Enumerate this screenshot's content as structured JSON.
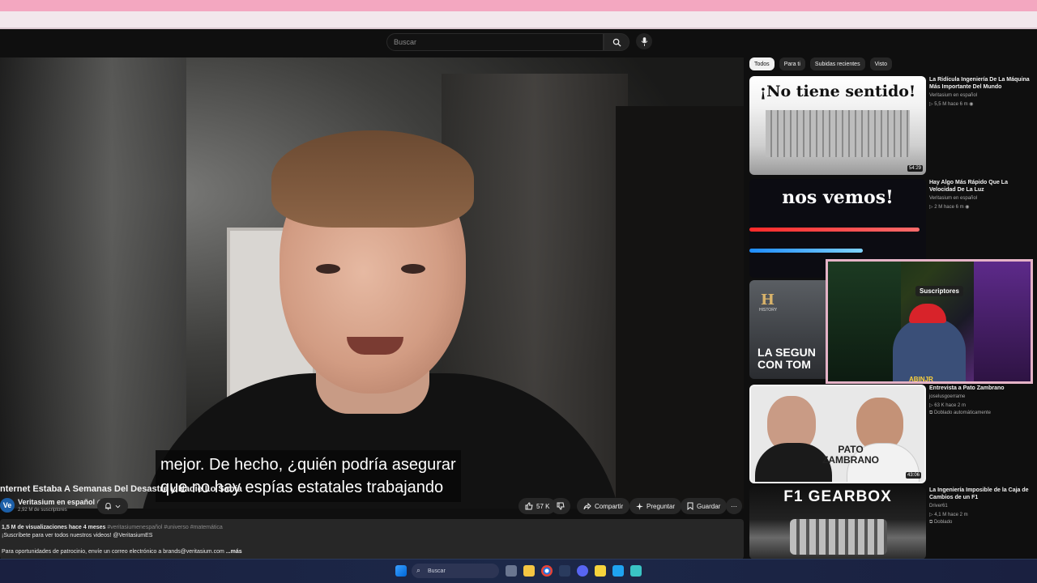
{
  "search": {
    "placeholder": "Buscar"
  },
  "video": {
    "subtitles": [
      "mejor. De hecho, ¿quién podría asegurar",
      "que no hay espías estatales trabajando"
    ],
    "title": "nternet Estaba A Semanas Del Desastre y Nadie Lo Sabía"
  },
  "channel": {
    "name": "Veritasium en español",
    "avatar_text": "Ve",
    "subscribers": "2,92 M de suscriptores"
  },
  "actions": {
    "likes": "57 K",
    "share": "Compartir",
    "ask": "Preguntar",
    "save": "Guardar"
  },
  "description": {
    "views_line": "1,5 M de visualizaciones  hace 4 meses",
    "hashtags": "#veritasiumenespañol #universo #matemática",
    "line2": "¡Suscríbete para ver todos nuestros videos! @VeritasiumES",
    "line3": "Para oportunidades de patrocinio, envíe un correo electrónico a brands@veritasium.com",
    "more": "...más"
  },
  "chips": [
    "Todos",
    "Para ti",
    "Subidas recientes",
    "Visto"
  ],
  "recommendations": [
    {
      "title": "La Ridícula Ingeniería De La Máquina Más Importante Del Mundo",
      "channel": "Veritasium en español",
      "meta": "5,5 M   hace 6 m",
      "thumb_text": "¡No tiene sentido!",
      "duration": "54:29"
    },
    {
      "title": "Hay Algo Más Rápido Que La Velocidad De La Luz",
      "channel": "Veritasium en español",
      "meta": "2 M   hace 6 m",
      "thumb_text": "nos vemos!"
    },
    {
      "thumb_text": "LA SEGUN CON TOM",
      "thumb_logo": "H",
      "thumb_logo_sub": "HISTORY"
    },
    {
      "title": "Entrevista a Pato Zambrano",
      "channel": "joselusgoerrame",
      "meta": "63 K   hace 2 m",
      "badge": "Doblado automáticamente",
      "thumb_text": "PATO ZAMBRANO",
      "duration": "43:06"
    },
    {
      "title": "La Ingeniería Imposible de la Caja de Cambios de un F1",
      "channel": "Driver61",
      "meta": "4,1 M   hace 2 m",
      "badge": "Doblado",
      "thumb_text": "F1 GEARBOX"
    }
  ],
  "overlay": {
    "label": "Suscriptores",
    "brand": "ABINJR"
  },
  "taskbar": {
    "search": "Buscar"
  },
  "colors": {
    "background": "#0f0f0f",
    "chip_active": "#f1f1f1",
    "accent_pink": "#f3a7c0"
  }
}
